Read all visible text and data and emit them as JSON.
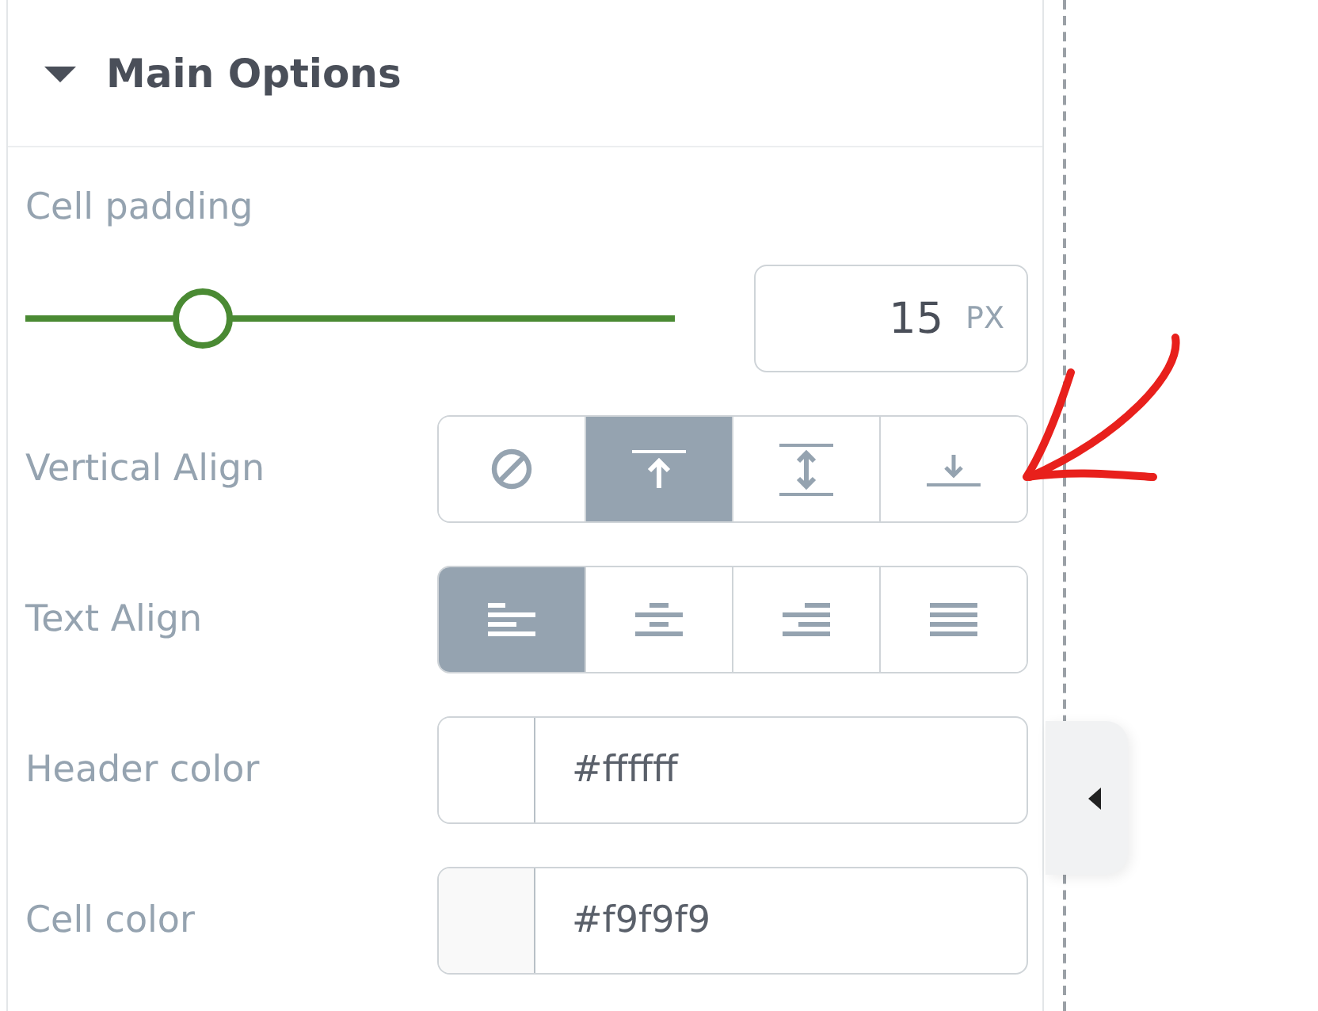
{
  "panel": {
    "title": "Main Options",
    "expanded": true,
    "slider": {
      "label": "Cell padding",
      "level": 0.28,
      "value": "15",
      "unit": "PX"
    },
    "rows": [
      {
        "kind": "buttons",
        "label": "Vertical Align",
        "options": [
          {
            "kind": "none",
            "selected": false
          },
          {
            "kind": "top",
            "selected": true
          },
          {
            "kind": "middle",
            "selected": false
          },
          {
            "kind": "bottom",
            "selected": false
          }
        ]
      },
      {
        "kind": "buttons",
        "label": "Text Align",
        "options": [
          {
            "kind": "left",
            "selected": true
          },
          {
            "kind": "center",
            "selected": false
          },
          {
            "kind": "right",
            "selected": false
          },
          {
            "kind": "justify",
            "selected": false
          }
        ]
      },
      {
        "kind": "color",
        "label": "Header color",
        "value": "#ffffff",
        "color": "#ffffff"
      },
      {
        "kind": "color",
        "label": "Cell color",
        "value": "#f9f9f9",
        "color": "#f9f9f9"
      }
    ]
  }
}
